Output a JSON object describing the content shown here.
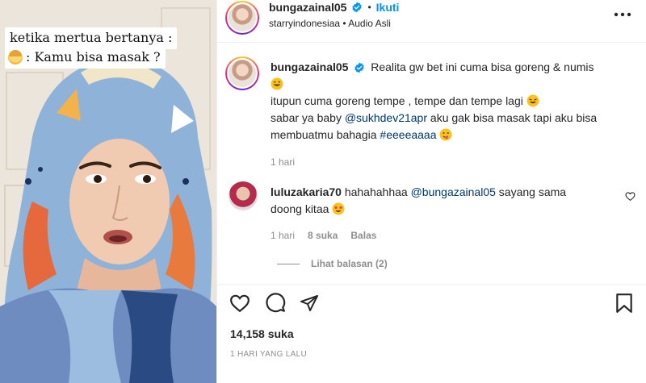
{
  "media": {
    "caption_line1": "ketika mertua bertanya :",
    "caption_line2": ": Kamu bisa masak ?"
  },
  "header": {
    "username": "bungazainal05",
    "separator": "•",
    "follow_label": "Ikuti",
    "audio_text": "starryindonesiaa • Audio Asli"
  },
  "post_caption": {
    "username": "bungazainal05",
    "line1": "Realita gw bet ini cuma bisa goreng & numis",
    "line2": "itupun cuma goreng tempe , tempe dan tempe lagi",
    "line3_prefix": "sabar ya baby",
    "line3_mention": "@sukhdev21apr",
    "line3_suffix": "aku gak bisa masak tapi aku bisa",
    "line4_prefix": "membuatmu bahagia",
    "line4_hashtag": "#eeeeaaaa",
    "time": "1 hari"
  },
  "comment": {
    "username": "luluzakaria70",
    "text_prefix": "hahahahhaa",
    "mention": "@bungazainal05",
    "text_suffix": "sayang sama",
    "line2": "doong kitaa",
    "time": "1 hari",
    "likes": "8 suka",
    "reply_label": "Balas",
    "view_replies": "Lihat balasan (2)"
  },
  "footer": {
    "likes": "14,158 suka",
    "date": "1 HARI YANG LALU"
  },
  "colors": {
    "accent": "#0095f6",
    "link": "#00376b",
    "verified": "#0095f6",
    "muted": "#8e8e8e"
  },
  "icons": [
    "more-icon",
    "verified-icon",
    "heart-icon",
    "comment-icon",
    "share-icon",
    "bookmark-icon",
    "comment-like-icon"
  ]
}
